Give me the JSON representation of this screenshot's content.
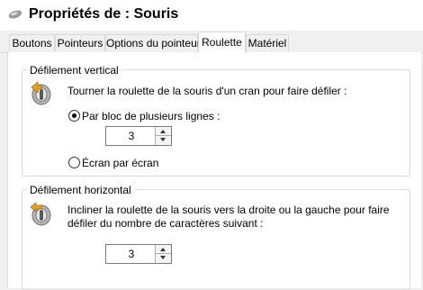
{
  "window": {
    "title": "Propriétés de : Souris",
    "icon": "mouse-icon"
  },
  "tabs": [
    {
      "label": "Boutons"
    },
    {
      "label": "Pointeurs"
    },
    {
      "label": "Options du pointeur"
    },
    {
      "label": "Roulette",
      "active": true
    },
    {
      "label": "Matériel"
    }
  ],
  "vertical": {
    "group_label": "Défilement vertical",
    "icon": "scroll-wheel-vertical-icon",
    "description": "Tourner la roulette de la souris d'un cran pour faire défiler :",
    "option_lines": "Par bloc de plusieurs lignes :",
    "lines_value": "3",
    "option_screen": "Écran par écran",
    "selected": "lines"
  },
  "horizontal": {
    "group_label": "Défilement horizontal",
    "icon": "scroll-wheel-horizontal-icon",
    "description_line1": "Incliner la roulette de la souris vers la droite ou la gauche pour faire",
    "description_line2": "défiler du nombre de caractères suivant :",
    "chars_value": "3"
  }
}
